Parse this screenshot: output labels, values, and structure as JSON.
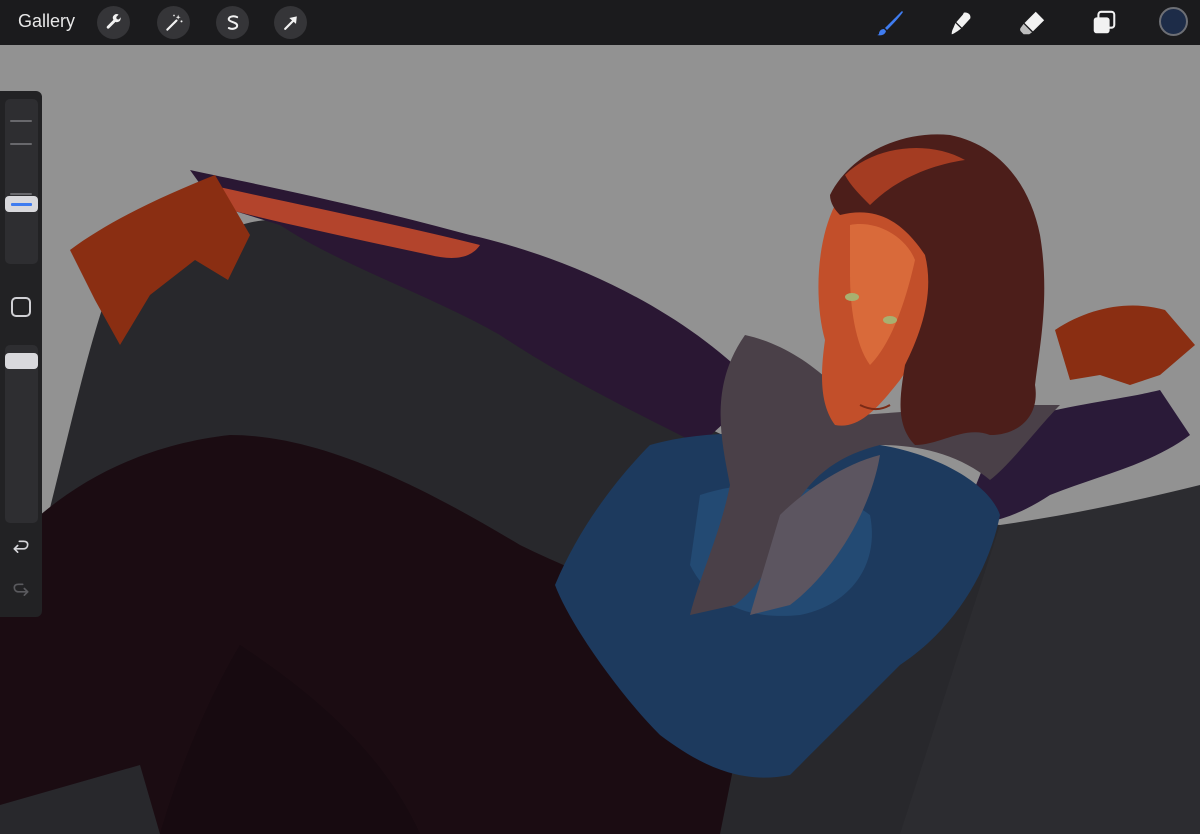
{
  "app": {
    "gallery_label": "Gallery"
  },
  "toolbar": {
    "left_tools": [
      "wrench-icon",
      "magic-wand-icon",
      "selection-s-icon",
      "transform-arrow-icon"
    ],
    "right_tools": [
      "brush-icon",
      "smudge-icon",
      "eraser-icon",
      "layers-icon"
    ],
    "active_tool": "brush-icon",
    "accent_color": "#3f7cf0",
    "current_color": "#1d2c48"
  },
  "sidebar": {
    "brush_size_level": 0.35,
    "opacity_level": 0.95
  },
  "colors": {
    "background": "#929292",
    "ui_bg": "#1b1b1d"
  }
}
